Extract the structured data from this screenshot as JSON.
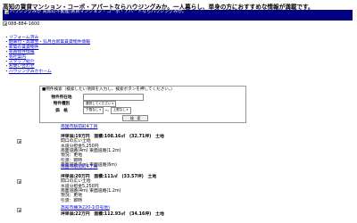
{
  "headline": "高知の賃貸マンション・コーポ・アパートならハウジングみか。一人暮らし、単身の方におすすめな情報が満載です。",
  "banner": {
    "logo_alt": "ハウジングみか 高知の不動産/賃貸マンション・コーポ・アパートならハウジングみか。"
  },
  "phone": "088-884-1600",
  "nav": [
    "リフォーム済み",
    "駐車付・高専生・弘月台新築賃貸物件情報",
    "新築の賃貸物件",
    "売買物件情報",
    "会社案内",
    "スタッフ紹介",
    "お問い合わせ",
    "ハウジングみかホーム"
  ],
  "search": {
    "note": "■物件検索（検索したい項目を入力し、検索ボタンを押してください。）",
    "rows": [
      {
        "label": "物件所在地",
        "control": "input",
        "value": ""
      },
      {
        "label": "物件種別",
        "control": "select",
        "value": "選択してください"
      },
      {
        "label": "価　格",
        "control": "price",
        "min": "下限なし",
        "sep": "〜",
        "max": "上限なし"
      }
    ],
    "button": "検　索"
  },
  "listings": [
    {
      "address": "南国市駅前町4丁目",
      "stats": "坪単価:19万円　面積:108.16㎡　(32.71坪)　土地",
      "details": [
        "間口の広い土地",
        "水道分担金5,250円",
        "南面道路(4m) 東面道路(1.2m)",
        "現況：更地",
        "引渡：即時",
        "南面道路(5m) 東面道路(6m)"
      ]
    },
    {
      "address": "南国市駅前町4丁目",
      "stats": "坪単価:20万円　面積:111㎡　(33.57坪)　土地",
      "details": [
        "間口の広い土地",
        "水道分担金5,250円",
        "南面道路(4m) 東面道路(1.2m)",
        "現況：更地",
        "引渡：即時"
      ]
    },
    {
      "address": "高知市横浜220-1(D号地)",
      "stats": "坪単価:22万円　面積:112.93㎡　(34.16坪)　土地",
      "details": []
    }
  ]
}
